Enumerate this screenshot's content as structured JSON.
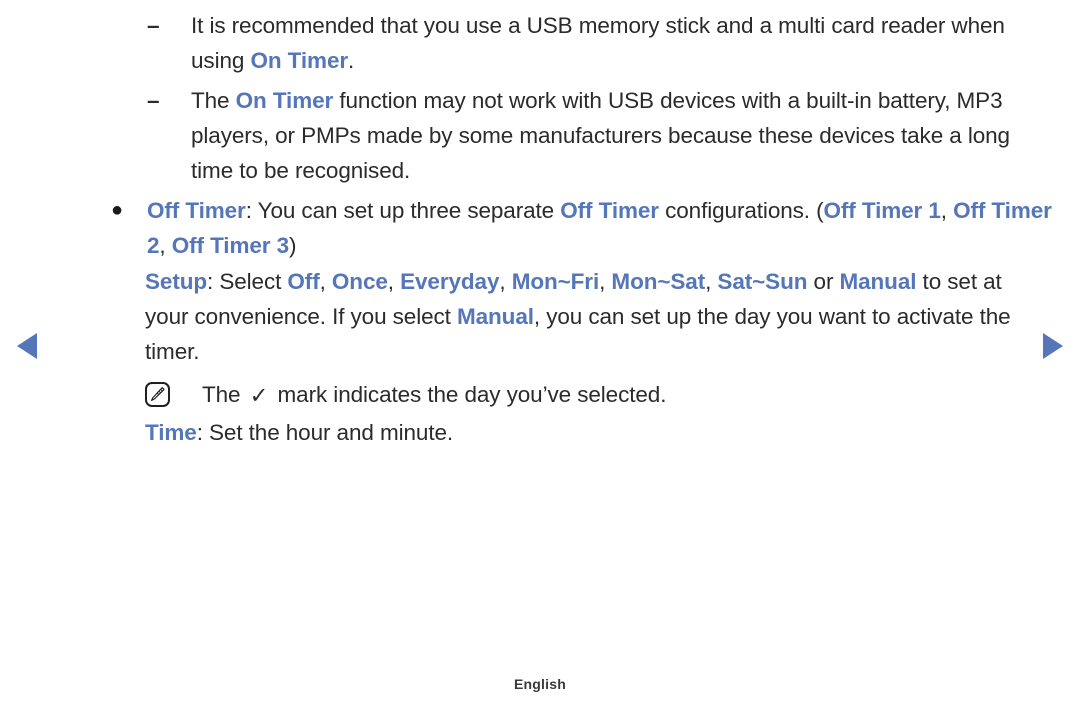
{
  "colors": {
    "accent": "#5576b8",
    "body_text": "#2b2b2b",
    "background": "#ffffff",
    "footer_text": "#3a3a3a"
  },
  "nav": {
    "prev_label": "previous page",
    "next_label": "next page",
    "prev_icon": "triangle-left-icon",
    "next_icon": "triangle-right-icon"
  },
  "content": {
    "dash_marker": "–",
    "bullet_marker": "●",
    "note_icon_name": "note-pencil-icon",
    "check_mark": "✓",
    "items": [
      {
        "id": "usb-recommendation",
        "type": "dash",
        "runs": [
          {
            "text": "It is recommended that you use a USB memory stick and a multi card reader when using ",
            "style": "plain"
          },
          {
            "text": "On Timer",
            "style": "highlight"
          },
          {
            "text": ".",
            "style": "plain"
          }
        ]
      },
      {
        "id": "on-timer-limitation",
        "type": "dash",
        "runs": [
          {
            "text": "The ",
            "style": "plain"
          },
          {
            "text": "On Timer",
            "style": "highlight"
          },
          {
            "text": " function may not work with USB devices with a built-in battery, MP3 players, or PMPs made by some manufacturers because these devices take a long time to be recognised.",
            "style": "plain"
          }
        ]
      },
      {
        "id": "off-timer-description",
        "type": "bullet",
        "runs": [
          {
            "text": "Off Timer",
            "style": "highlight"
          },
          {
            "text": ": You can set up three separate ",
            "style": "plain"
          },
          {
            "text": "Off Timer",
            "style": "highlight"
          },
          {
            "text": " configurations. (",
            "style": "plain"
          },
          {
            "text": "Off Timer 1",
            "style": "highlight"
          },
          {
            "text": ", ",
            "style": "plain"
          },
          {
            "text": "Off Timer 2",
            "style": "highlight"
          },
          {
            "text": ", ",
            "style": "plain"
          },
          {
            "text": "Off Timer 3",
            "style": "highlight"
          },
          {
            "text": ")",
            "style": "plain"
          }
        ]
      },
      {
        "id": "setup-description",
        "type": "para",
        "runs": [
          {
            "text": "Setup",
            "style": "highlight"
          },
          {
            "text": ": Select ",
            "style": "plain"
          },
          {
            "text": "Off",
            "style": "highlight"
          },
          {
            "text": ", ",
            "style": "plain"
          },
          {
            "text": "Once",
            "style": "highlight"
          },
          {
            "text": ", ",
            "style": "plain"
          },
          {
            "text": "Everyday",
            "style": "highlight"
          },
          {
            "text": ", ",
            "style": "plain"
          },
          {
            "text": "Mon~Fri",
            "style": "highlight"
          },
          {
            "text": ", ",
            "style": "plain"
          },
          {
            "text": "Mon~Sat",
            "style": "highlight"
          },
          {
            "text": ", ",
            "style": "plain"
          },
          {
            "text": "Sat~Sun",
            "style": "highlight"
          },
          {
            "text": " or ",
            "style": "plain"
          },
          {
            "text": "Manual",
            "style": "highlight"
          },
          {
            "text": " to set at your convenience. If you select ",
            "style": "plain"
          },
          {
            "text": "Manual",
            "style": "highlight"
          },
          {
            "text": ", you can set up the day you want to activate the timer.",
            "style": "plain"
          }
        ]
      },
      {
        "id": "check-mark-note",
        "type": "note",
        "runs": [
          {
            "text": "The ",
            "style": "plain"
          },
          {
            "text": "✓",
            "style": "check"
          },
          {
            "text": " mark indicates the day you’ve selected.",
            "style": "plain"
          }
        ]
      },
      {
        "id": "time-description",
        "type": "para",
        "runs": [
          {
            "text": "Time",
            "style": "highlight"
          },
          {
            "text": ": Set the hour and minute.",
            "style": "plain"
          }
        ]
      }
    ]
  },
  "footer": {
    "language": "English"
  }
}
